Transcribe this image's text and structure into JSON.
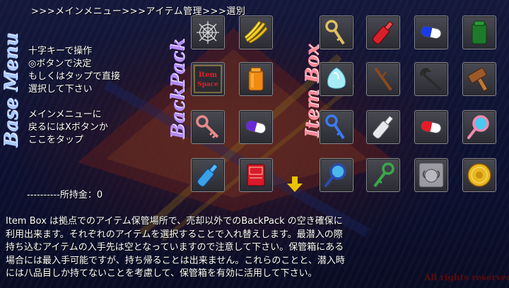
{
  "breadcrumb": ">>>メインメニュー>>>アイテム管理>>>選別",
  "titles": {
    "base_menu": "Base Menu",
    "backpack": "BackPack",
    "item_box": "Item Box"
  },
  "instructions": [
    " 十字キーで操作",
    "◎ボタンで決定",
    " もしくはタップで直接",
    "選択して下さい",
    "",
    " メインメニューに",
    "戻るにはXボタンか",
    "ここをタップ"
  ],
  "money_label": "----------所持金：0",
  "backpack": {
    "slots": [
      {
        "icon": "spider-web-icon"
      },
      {
        "icon": "banana-bunch-icon"
      },
      {
        "icon": "item-space-icon",
        "line1": "Item",
        "line2": "Space"
      },
      {
        "icon": "orange-canister-icon"
      },
      {
        "icon": "pink-key-icon"
      },
      {
        "icon": "purple-white-capsule-icon"
      },
      {
        "icon": "blue-bottle-icon"
      },
      {
        "icon": "red-book-icon"
      }
    ]
  },
  "item_box": {
    "slots": [
      {
        "icon": "gold-key-icon"
      },
      {
        "icon": "red-bottle-icon"
      },
      {
        "icon": "blue-white-capsule-icon"
      },
      {
        "icon": "green-canister-icon"
      },
      {
        "icon": "ice-crystal-icon"
      },
      {
        "icon": "wooden-stick-icon"
      },
      {
        "icon": "crowbar-icon"
      },
      {
        "icon": "wooden-hammer-icon"
      },
      {
        "icon": "blue-key-icon"
      },
      {
        "icon": "white-bottle-icon"
      },
      {
        "icon": "red-white-capsule-icon"
      },
      {
        "icon": "pink-magnifier-icon"
      },
      {
        "icon": "blue-magnifier-icon"
      },
      {
        "icon": "green-key-icon"
      },
      {
        "icon": "ram-emblem-icon"
      },
      {
        "icon": "gold-medal-icon"
      }
    ]
  },
  "scroll_arrow": "down-arrow-icon",
  "description": [
    "Item Box は拠点でのアイテム保管場所で、売却以外でのBackPack の空き確保に",
    "利用出来ます。それぞれのアイテムを選択することで入れ替えします。最潜入の際",
    "持ち込むアイテムの入手先は空となっていますので注意して下さい。保管箱にある",
    "場合には最入手可能ですが、持ち帰ることは出来ません。これらのことと、潜入時",
    "には八品目しか持てないことを考慮して、保管箱を有効に活用して下さい。"
  ],
  "copyright": "All rights reserved",
  "colors": {
    "base_menu": "#a9c8ff",
    "backpack": "#b48cff",
    "item_box": "#ff8a9a",
    "arrow": "#e8c400"
  }
}
